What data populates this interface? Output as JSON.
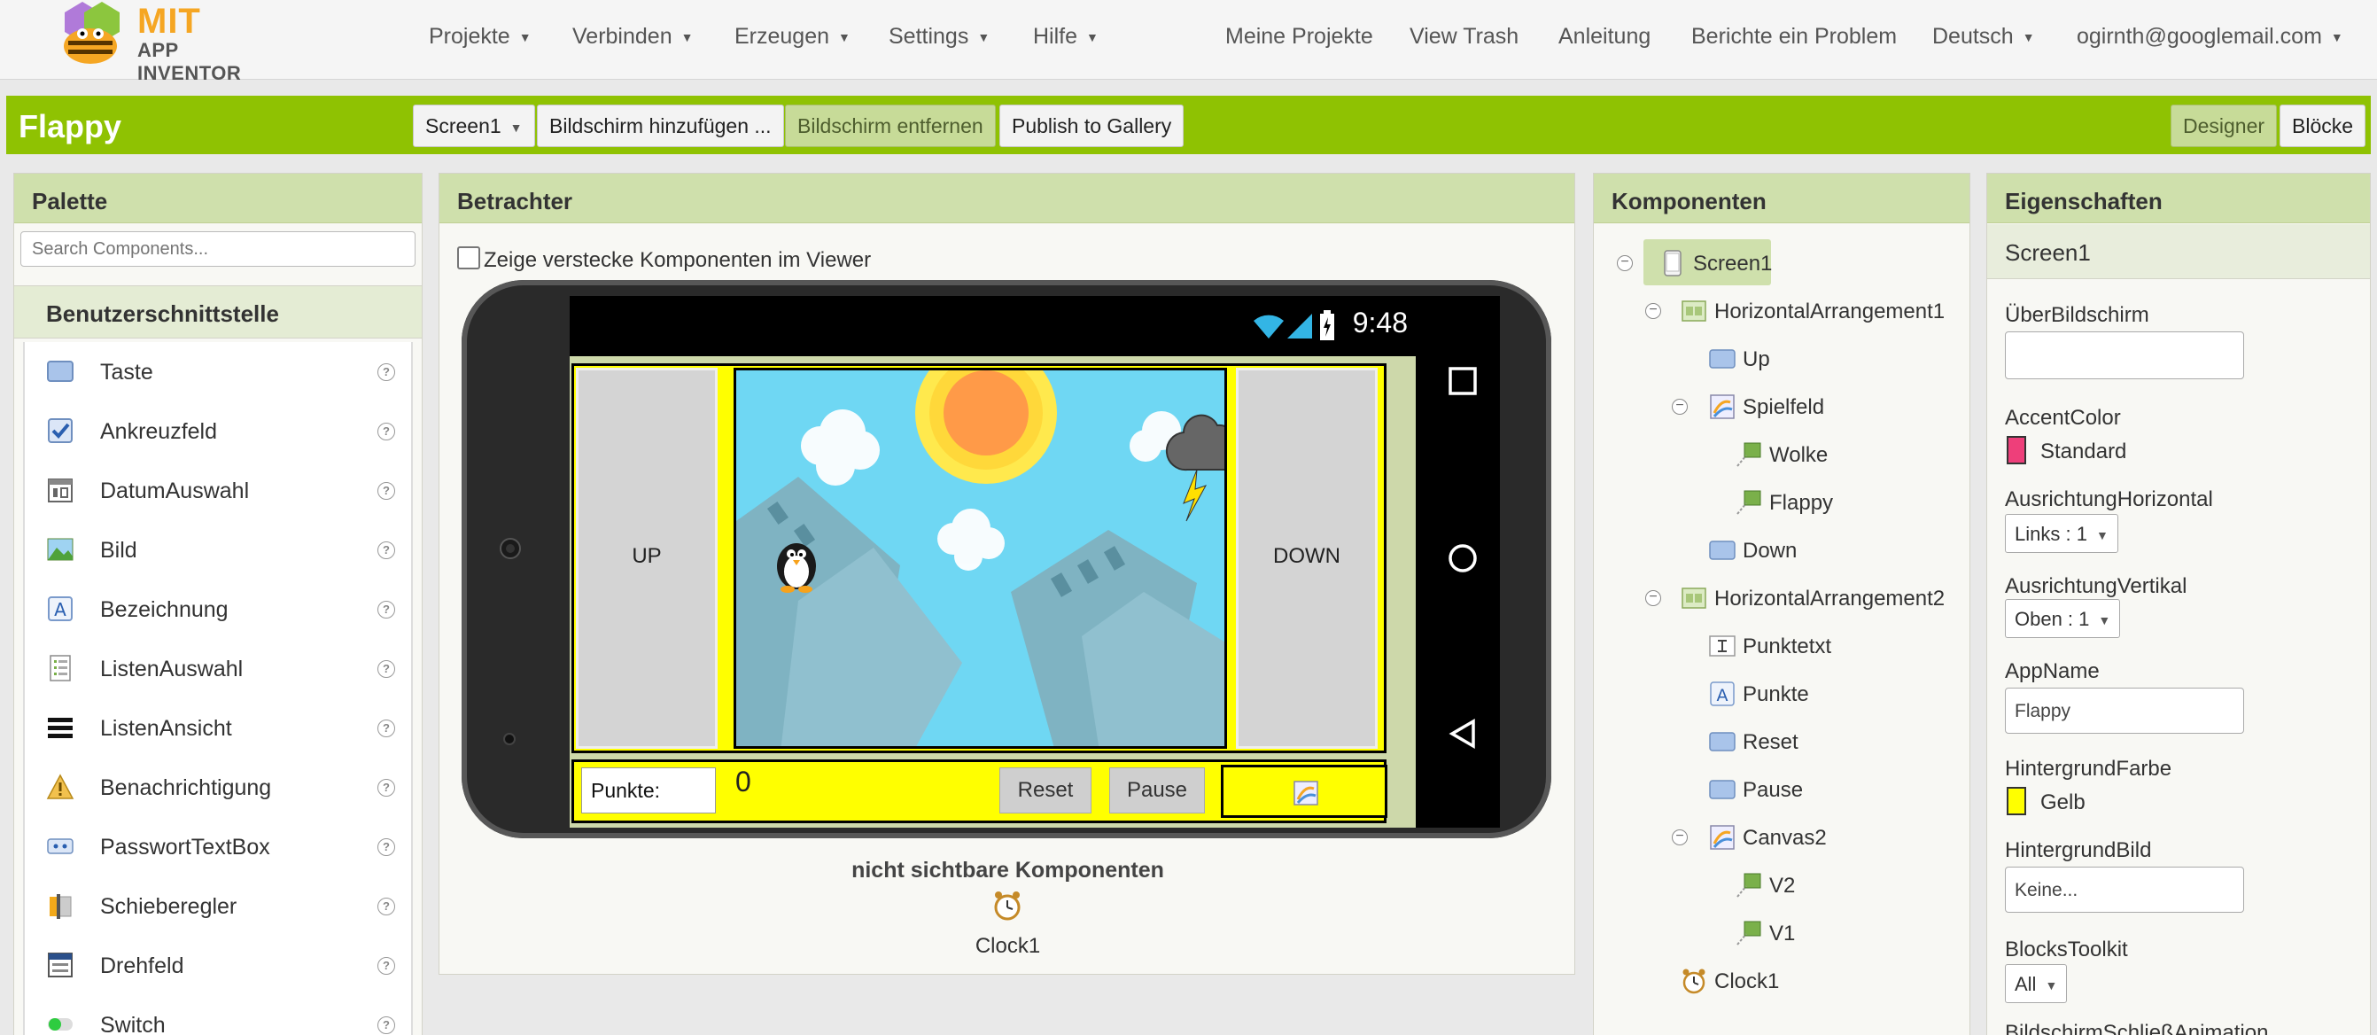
{
  "brand": {
    "line1": "MIT",
    "line2": "APP INVENTOR"
  },
  "nav": {
    "menus": [
      "Projekte",
      "Verbinden",
      "Erzeugen",
      "Settings",
      "Hilfe"
    ],
    "links": [
      "Meine Projekte",
      "View Trash",
      "Anleitung",
      "Berichte ein Problem"
    ],
    "language": "Deutsch",
    "user": "ogirnth@googlemail.com"
  },
  "project": {
    "name": "Flappy",
    "screen_select": "Screen1",
    "add_screen": "Bildschirm hinzufügen ...",
    "remove_screen": "Bildschirm entfernen",
    "publish": "Publish to Gallery",
    "designer": "Designer",
    "blocks": "Blöcke"
  },
  "palette": {
    "title": "Palette",
    "search_placeholder": "Search Components...",
    "category": "Benutzerschnittstelle",
    "items": [
      {
        "label": "Taste",
        "icon": "button-icon"
      },
      {
        "label": "Ankreuzfeld",
        "icon": "checkbox-icon"
      },
      {
        "label": "DatumAuswahl",
        "icon": "calendar-icon"
      },
      {
        "label": "Bild",
        "icon": "image-icon"
      },
      {
        "label": "Bezeichnung",
        "icon": "label-icon"
      },
      {
        "label": "ListenAuswahl",
        "icon": "listpicker-icon"
      },
      {
        "label": "ListenAnsicht",
        "icon": "listview-icon"
      },
      {
        "label": "Benachrichtigung",
        "icon": "warning-icon"
      },
      {
        "label": "PasswortTextBox",
        "icon": "password-icon"
      },
      {
        "label": "Schieberegler",
        "icon": "slider-icon"
      },
      {
        "label": "Drehfeld",
        "icon": "spinner-icon"
      },
      {
        "label": "Switch",
        "icon": "switch-icon"
      }
    ]
  },
  "viewer": {
    "title": "Betrachter",
    "show_hidden_label": "Zeige verstecke Komponenten im Viewer",
    "status_time": "9:48",
    "up_button": "UP",
    "down_button": "DOWN",
    "score_box": "Punkte:",
    "score_value": "0",
    "reset_button": "Reset",
    "pause_button": "Pause",
    "nonvisible_title": "nicht sichtbare Komponenten",
    "nonvisible_clock": "Clock1"
  },
  "components": {
    "title": "Komponenten",
    "tree": [
      {
        "label": "Screen1",
        "icon": "screen-icon",
        "toggle": true
      },
      {
        "label": "HorizontalArrangement1",
        "icon": "arrangement-icon",
        "toggle": true
      },
      {
        "label": "Up",
        "icon": "button-icon",
        "toggle": false
      },
      {
        "label": "Spielfeld",
        "icon": "canvas-icon",
        "toggle": true
      },
      {
        "label": "Wolke",
        "icon": "sprite-icon",
        "toggle": false
      },
      {
        "label": "Flappy",
        "icon": "sprite-icon",
        "toggle": false
      },
      {
        "label": "Down",
        "icon": "button-icon",
        "toggle": false
      },
      {
        "label": "HorizontalArrangement2",
        "icon": "arrangement-icon",
        "toggle": true
      },
      {
        "label": "Punktetxt",
        "icon": "textbox-icon",
        "toggle": false
      },
      {
        "label": "Punkte",
        "icon": "label-icon",
        "toggle": false
      },
      {
        "label": "Reset",
        "icon": "button-icon",
        "toggle": false
      },
      {
        "label": "Pause",
        "icon": "button-icon",
        "toggle": false
      },
      {
        "label": "Canvas2",
        "icon": "canvas-icon",
        "toggle": true
      },
      {
        "label": "V2",
        "icon": "sprite-icon",
        "toggle": false
      },
      {
        "label": "V1",
        "icon": "sprite-icon",
        "toggle": false
      },
      {
        "label": "Clock1",
        "icon": "clock-icon",
        "toggle": false
      }
    ]
  },
  "properties": {
    "title": "Eigenschaften",
    "object": "Screen1",
    "about_label": "ÜberBildschirm",
    "about_value": "",
    "accent_label": "AccentColor",
    "accent_value": "Standard",
    "accent_color": "#ee3f7a",
    "align_h_label": "AusrichtungHorizontal",
    "align_h_value": "Links : 1",
    "align_v_label": "AusrichtungVertikal",
    "align_v_value": "Oben : 1",
    "appname_label": "AppName",
    "appname_value": "Flappy",
    "bgcolor_label": "HintergrundFarbe",
    "bgcolor_value": "Gelb",
    "bgcolor_color": "#ffff00",
    "bgimage_label": "HintergrundBild",
    "bgimage_value": "Keine...",
    "toolkit_label": "BlocksToolkit",
    "toolkit_value": "All",
    "close_anim_label": "BildschirmSchließAnimation"
  }
}
